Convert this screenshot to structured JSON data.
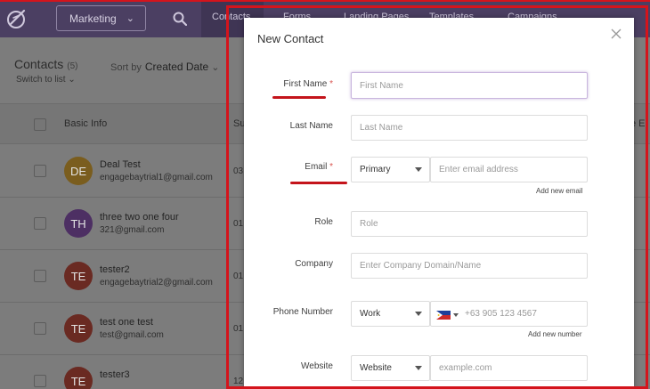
{
  "nav": {
    "workspace": "Marketing",
    "tabs": [
      "Contacts",
      "Forms",
      "Landing Pages",
      "Templates",
      "Campaigns"
    ]
  },
  "contacts": {
    "title": "Contacts",
    "count": "(5)",
    "sort_label": "Sort by",
    "sort_value": "Created Date",
    "switch_view": "Switch to list",
    "columns": {
      "basic_info": "Basic Info",
      "s": "Su",
      "e": "e E"
    },
    "rows": [
      {
        "initials": "DE",
        "color": "#7a5d1e",
        "name": "Deal Test",
        "email": "engagebaytrial1@gmail.com",
        "num": "03"
      },
      {
        "initials": "TH",
        "color": "#4d2f63",
        "name": "three two one four",
        "email": "321@gmail.com",
        "num": "01"
      },
      {
        "initials": "TE",
        "color": "#6a2a22",
        "name": "tester2",
        "email": "engagebaytrial2@gmail.com",
        "num": "01"
      },
      {
        "initials": "TE",
        "color": "#6a2a22",
        "name": "test one test",
        "email": "test@gmail.com",
        "num": "01"
      },
      {
        "initials": "TE",
        "color": "#6a2a22",
        "name": "tester3",
        "email": "",
        "num": "12"
      }
    ]
  },
  "modal": {
    "title": "New Contact",
    "first_name": {
      "label": "First Name",
      "placeholder": "First Name"
    },
    "last_name": {
      "label": "Last Name",
      "placeholder": "Last Name"
    },
    "email": {
      "label": "Email",
      "type": "Primary",
      "placeholder": "Enter email address",
      "add_link": "Add new email"
    },
    "role": {
      "label": "Role",
      "placeholder": "Role"
    },
    "company": {
      "label": "Company",
      "placeholder": "Enter Company Domain/Name"
    },
    "phone": {
      "label": "Phone Number",
      "type": "Work",
      "placeholder": "+63 905 123 4567",
      "add_link": "Add new number"
    },
    "website": {
      "label": "Website",
      "type": "Website",
      "placeholder": "example.com"
    },
    "required_mark": "*"
  },
  "colors": {
    "accent": "#4b3f62",
    "annotation": "#d4141c",
    "required": "#d9534f"
  }
}
